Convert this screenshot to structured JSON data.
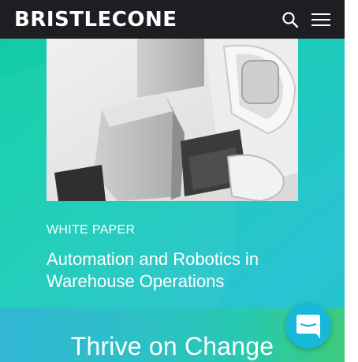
{
  "header": {
    "logo_text": "BRISTLECONE",
    "search_icon": "search-icon",
    "menu_icon": "hamburger-menu-icon"
  },
  "hero": {
    "image_icon": "robot-arm-image"
  },
  "content": {
    "eyebrow": "WHITE PAPER",
    "title": "Automation and Robotics in Warehouse Operations"
  },
  "banner": {
    "title": "Thrive on Change"
  },
  "chat": {
    "icon": "chat-bubble-icon"
  },
  "colors": {
    "header_bg": "#1d1d22",
    "accent_teal": "#17cfb1",
    "chat_button": "#18b9d8"
  }
}
